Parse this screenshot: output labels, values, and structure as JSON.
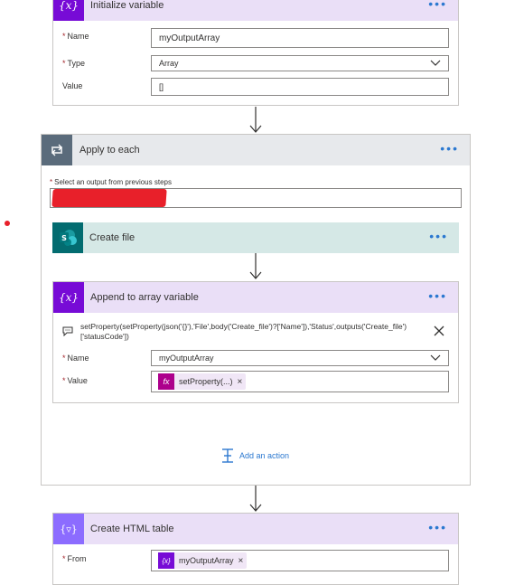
{
  "initialize_variable": {
    "title": "Initialize variable",
    "name_label": "Name",
    "name_value": "myOutputArray",
    "type_label": "Type",
    "type_value": "Array",
    "value_label": "Value",
    "value_value": "[]"
  },
  "apply_to_each": {
    "title": "Apply to each",
    "select_label": "Select an output from previous steps"
  },
  "create_file": {
    "title": "Create file"
  },
  "append_to_array": {
    "title": "Append to array variable",
    "expression_line1": "setProperty(setProperty(json('{}'),'File',body('Create_file')?['Name']),'Status',outputs('Create_file')",
    "expression_line2": "['statusCode'])",
    "name_label": "Name",
    "name_value": "myOutputArray",
    "value_label": "Value",
    "value_token": "setProperty(...)",
    "token_icon": "fx"
  },
  "add_action": {
    "label": "Add an action"
  },
  "create_html_table": {
    "title": "Create HTML table",
    "from_label": "From",
    "from_token": "myOutputArray"
  },
  "colors": {
    "variable_purple": "#770bd6",
    "loop_gray": "#5a6b7b",
    "sharepoint_teal": "#036c70",
    "accent_blue": "#2b78d0",
    "redaction_red": "#e8202a"
  },
  "icons": {
    "variable": "variable-x-icon",
    "loop": "loop-icon",
    "sharepoint": "sharepoint-icon",
    "more": "more-dots-icon",
    "dropdown": "chevron-down-icon",
    "close": "close-icon",
    "comment": "comment-icon",
    "add": "add-action-icon",
    "arrow": "arrow-down-icon"
  }
}
